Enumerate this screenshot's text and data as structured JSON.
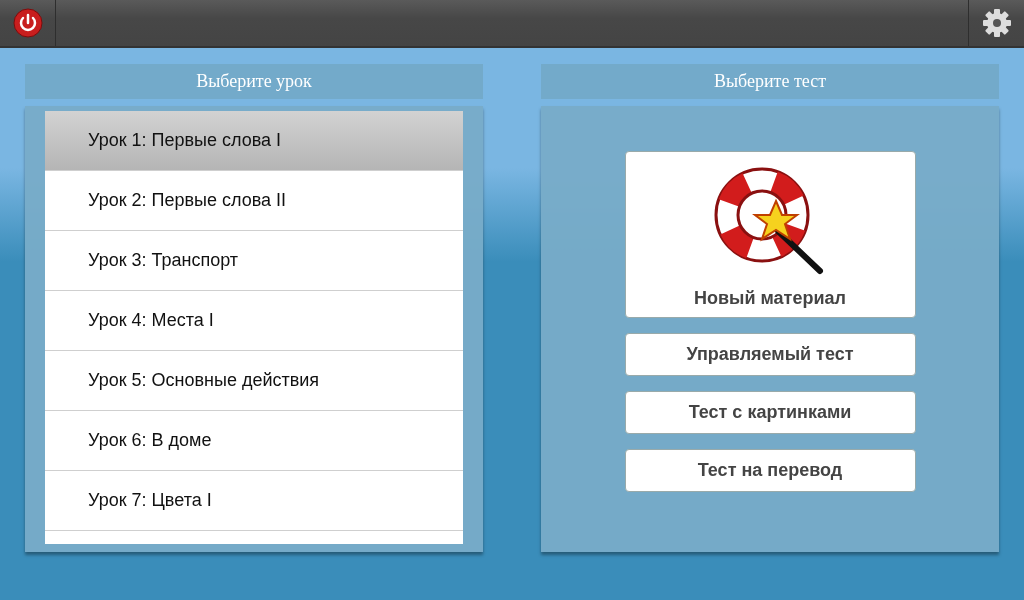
{
  "lessons_panel": {
    "title": "Выберите урок",
    "lessons": [
      {
        "label": "Урок 1: Первые слова I",
        "selected": true
      },
      {
        "label": "Урок 2: Первые слова II",
        "selected": false
      },
      {
        "label": "Урок 3: Транспорт",
        "selected": false
      },
      {
        "label": "Урок 4: Места I",
        "selected": false
      },
      {
        "label": "Урок 5: Основные действия",
        "selected": false
      },
      {
        "label": "Урок 6: В доме",
        "selected": false
      },
      {
        "label": "Урок 7: Цвета I",
        "selected": false
      }
    ]
  },
  "tests_panel": {
    "title": "Выберите тест",
    "tests": [
      {
        "label": "Новый материал",
        "kind": "featured"
      },
      {
        "label": "Управляемый тест",
        "kind": "plain"
      },
      {
        "label": "Тест с картинками",
        "kind": "plain"
      },
      {
        "label": "Тест на перевод",
        "kind": "plain"
      }
    ]
  }
}
